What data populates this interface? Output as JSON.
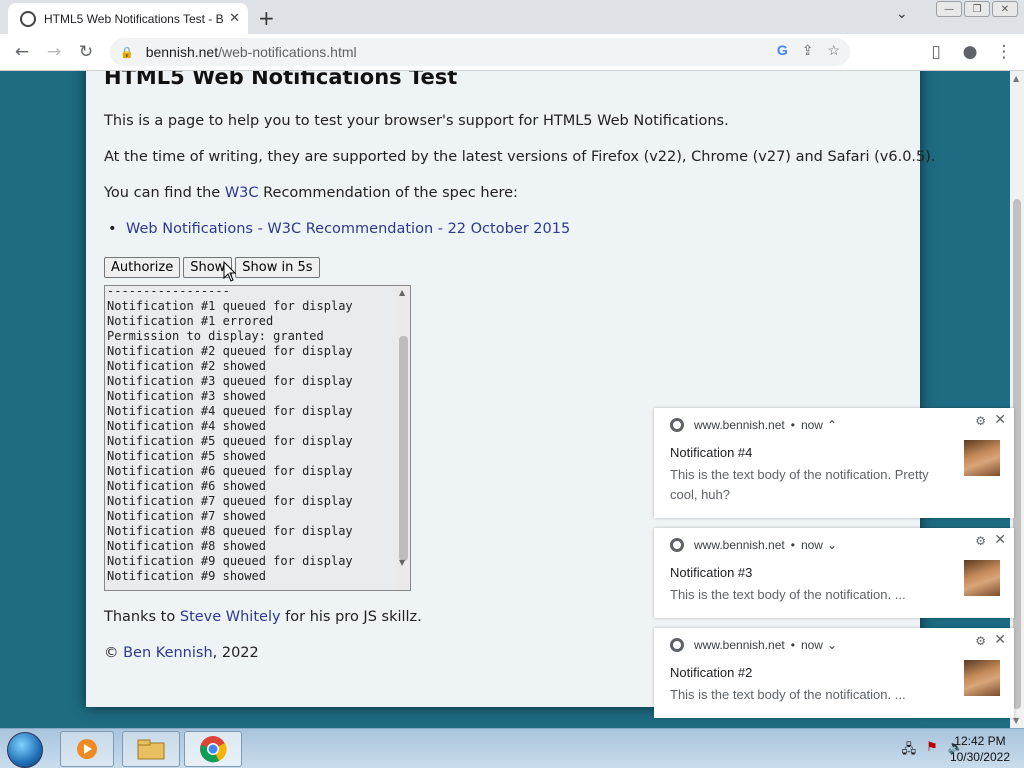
{
  "browser": {
    "tab_title": "HTML5 Web Notifications Test - B",
    "url_domain": "bennish.net",
    "url_path": "/web-notifications.html"
  },
  "page": {
    "title": "HTML5 Web Notifications Test",
    "intro": "This is a page to help you to test your browser's support for HTML5 Web Notifications.",
    "support": "At the time of writing, they are supported by the latest versions of Firefox (v22), Chrome (v27) and Safari (v6.0.5).",
    "spec_pre": "You can find the ",
    "spec_link": "W3C",
    "spec_post": " Recommendation of the spec here:",
    "spec_item": "Web Notifications - W3C Recommendation - 22 October 2015",
    "buttons": {
      "authorize": "Authorize",
      "show": "Show",
      "show_5s": "Show in 5s"
    },
    "log": "-----------------\nNotification #1 queued for display\nNotification #1 errored\nPermission to display: granted\nNotification #2 queued for display\nNotification #2 showed\nNotification #3 queued for display\nNotification #3 showed\nNotification #4 queued for display\nNotification #4 showed\nNotification #5 queued for display\nNotification #5 showed\nNotification #6 queued for display\nNotification #6 showed\nNotification #7 queued for display\nNotification #7 showed\nNotification #8 queued for display\nNotification #8 showed\nNotification #9 queued for display\nNotification #9 showed",
    "thanks_pre": "Thanks to ",
    "thanks_link": "Steve Whitely",
    "thanks_post": " for his pro JS skillz.",
    "copy_pre": "© ",
    "copy_link": "Ben Kennish",
    "copy_post": ", 2022"
  },
  "notifications": [
    {
      "site": "www.bennish.net",
      "time": "now",
      "chevron": "⌃",
      "title": "Notification #4",
      "body": "This is the text body of the notification. Pretty cool, huh?"
    },
    {
      "site": "www.bennish.net",
      "time": "now",
      "chevron": "⌄",
      "title": "Notification #3",
      "body": "This is the text body of the notification. ..."
    },
    {
      "site": "www.bennish.net",
      "time": "now",
      "chevron": "⌄",
      "title": "Notification #2",
      "body": "This is the text body of the notification. ..."
    }
  ],
  "taskbar": {
    "time": "12:42 PM",
    "date": "10/30/2022"
  }
}
